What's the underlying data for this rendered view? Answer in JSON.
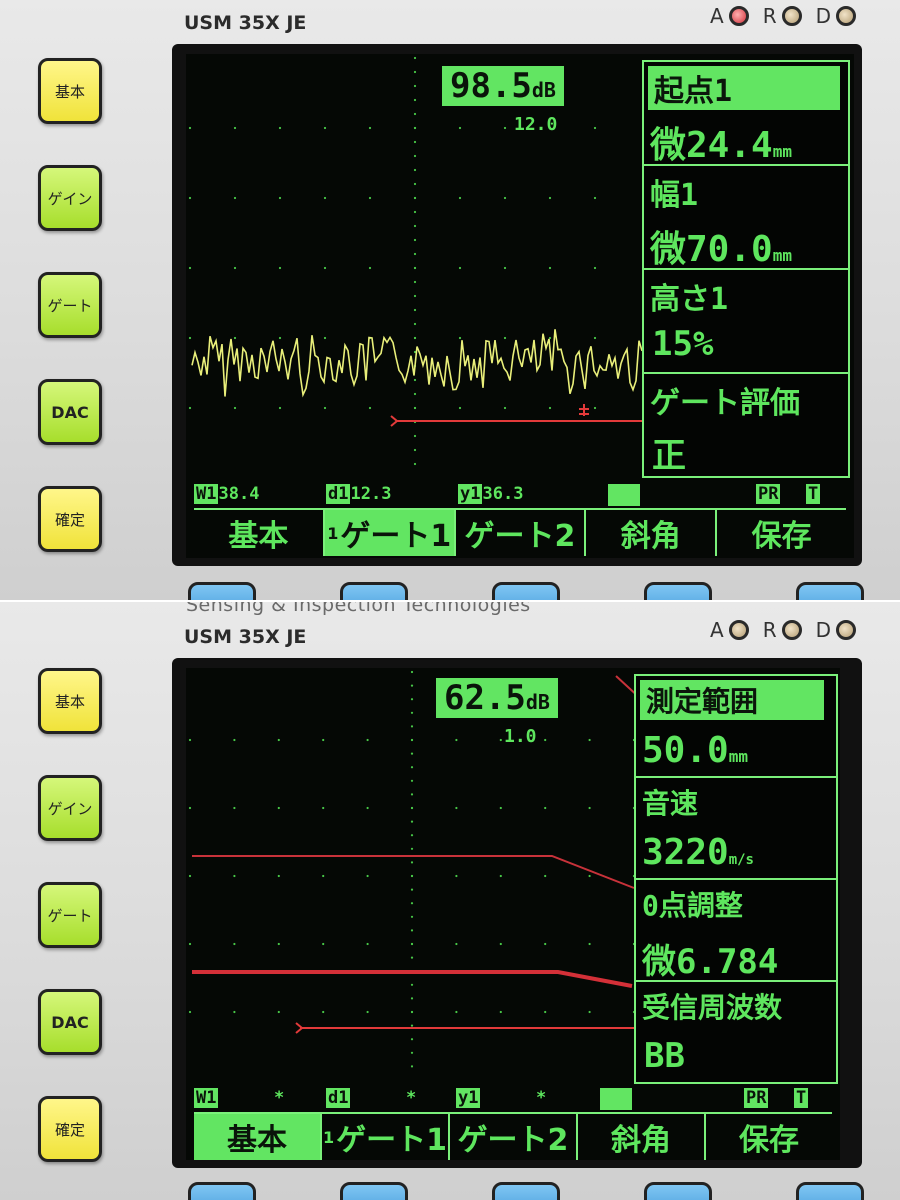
{
  "device": {
    "brand_partial": "Sensing & Inspection Technologies",
    "model": "USM 35X JE",
    "leds": [
      {
        "label": "A",
        "state": "on"
      },
      {
        "label": "R",
        "state": "off"
      },
      {
        "label": "D",
        "state": "off"
      }
    ],
    "side_keys": [
      "基本",
      "ゲイン",
      "ゲート",
      "DAC",
      "確定"
    ]
  },
  "top_screen": {
    "gain": "98.5",
    "gain_unit": "dB",
    "range_step": "12.0",
    "panel": [
      {
        "label": "起点1",
        "value": "微24.4",
        "unit": "mm"
      },
      {
        "label": "幅1",
        "value": "微70.0",
        "unit": "mm"
      },
      {
        "label": "高さ1",
        "value": "15%"
      },
      {
        "label": "ゲート評価",
        "value": "正"
      }
    ],
    "status": {
      "w_label": "W1",
      "w_value": "38.4",
      "d_label": "d1",
      "d_value": "12.3",
      "y_label": "y1",
      "y_value": "36.3",
      "pr": "PR",
      "t": "T"
    },
    "menu": [
      {
        "label": "基本",
        "active": false
      },
      {
        "label": "ゲート1",
        "prefix": "1",
        "active": true
      },
      {
        "label": "ゲート2",
        "active": false
      },
      {
        "label": "斜角",
        "active": false
      },
      {
        "label": "保存",
        "active": false
      }
    ]
  },
  "bottom_screen": {
    "gain": "62.5",
    "gain_unit": "dB",
    "range_step": "1.0",
    "panel": [
      {
        "label": "測定範囲",
        "value": "50.0",
        "unit": "mm"
      },
      {
        "label": "音速",
        "value": "3220",
        "unit": "m/s"
      },
      {
        "label": "0点調整",
        "value": "微6.784"
      },
      {
        "label": "受信周波数",
        "value": "BB"
      }
    ],
    "status": {
      "w_label": "W1",
      "w_value": "*",
      "d_label": "d1",
      "d_value": "*",
      "y_label": "y1",
      "y_value": "*",
      "pr": "PR",
      "t": "T"
    },
    "menu": [
      {
        "label": "基本",
        "active": true
      },
      {
        "label": "ゲート1",
        "prefix": "1",
        "active": false
      },
      {
        "label": "ゲート2",
        "active": false
      },
      {
        "label": "斜角",
        "active": false
      },
      {
        "label": "保存",
        "active": false
      }
    ]
  }
}
